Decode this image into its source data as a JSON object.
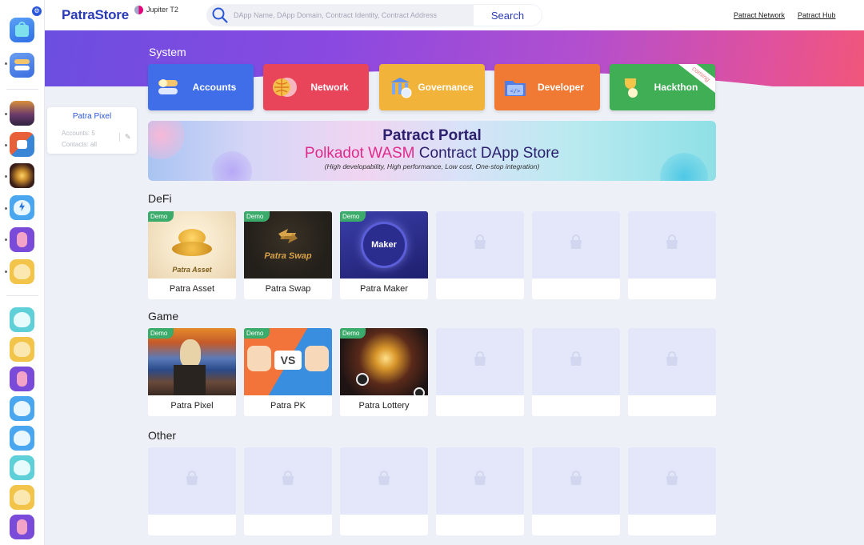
{
  "header": {
    "logo": "PatraStore",
    "network": "Jupiter T2",
    "search_placeholder": "DApp Name, DApp Domain, Contract Identity, Contract Address",
    "search_button": "Search",
    "links": [
      "Patract Network",
      "Patract Hub"
    ]
  },
  "hovercard": {
    "title": "Patra Pixel",
    "accounts": "Accounts: 5",
    "contacts": "Contacts: all"
  },
  "system": {
    "title": "System",
    "cards": [
      {
        "label": "Accounts",
        "color": "#3f6ee8"
      },
      {
        "label": "Network",
        "color": "#e8455a"
      },
      {
        "label": "Governance",
        "color": "#f2b33a"
      },
      {
        "label": "Developer",
        "color": "#f07a34"
      },
      {
        "label": "Hackthon",
        "color": "#3fae55",
        "ribbon": "coming"
      }
    ]
  },
  "portal": {
    "title": "Patract Portal",
    "subtitle_highlight": "Polkadot WASM",
    "subtitle_rest": " Contract DApp Store",
    "tagline": "(High developability, High performance, Low cost, One-stop integration)"
  },
  "sections": {
    "defi": {
      "title": "DeFi",
      "apps": [
        {
          "name": "Patra Asset",
          "badge": "Demo",
          "caption": "Patra Asset"
        },
        {
          "name": "Patra Swap",
          "badge": "Demo",
          "caption": "Patra Swap"
        },
        {
          "name": "Patra Maker",
          "badge": "Demo",
          "caption": "Maker"
        }
      ]
    },
    "game": {
      "title": "Game",
      "apps": [
        {
          "name": "Patra Pixel",
          "badge": "Demo"
        },
        {
          "name": "Patra PK",
          "badge": "Demo",
          "caption": "VS"
        },
        {
          "name": "Patra Lottery",
          "badge": "Demo"
        }
      ]
    },
    "other": {
      "title": "Other"
    }
  }
}
